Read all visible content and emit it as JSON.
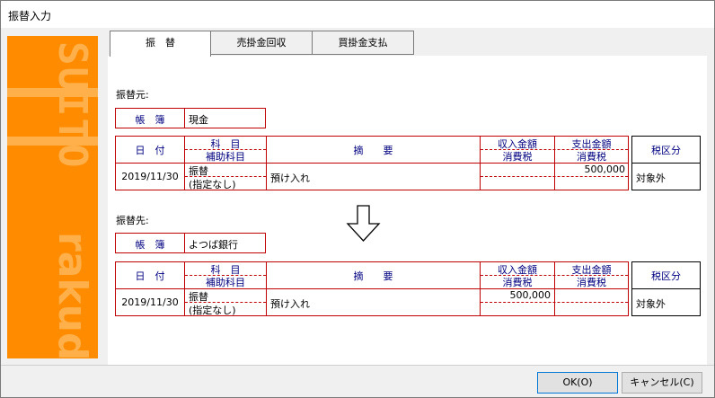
{
  "window": {
    "title": "振替入力"
  },
  "sidebar": {
    "logo_text_1": "SUITO",
    "logo_text_2": "rakuda"
  },
  "tabs": [
    {
      "label": "振　替",
      "active": true
    },
    {
      "label": "売掛金回収",
      "active": false
    },
    {
      "label": "買掛金支払",
      "active": false
    }
  ],
  "source": {
    "section_label": "振替元:",
    "book_label": "帳　簿",
    "book_value": "現金",
    "headers": {
      "date": "日　付",
      "account": "科　目",
      "sub_account": "補助科目",
      "summary": "摘　　要",
      "income": "収入金額",
      "income_tax": "消費税",
      "expense": "支出金額",
      "expense_tax": "消費税",
      "tax_class": "税区分"
    },
    "row": {
      "date": "2019/11/30",
      "account": "振替",
      "sub_account": "(指定なし)",
      "summary": "預け入れ",
      "income": "",
      "income_tax": "",
      "expense": "500,000",
      "expense_tax": "",
      "tax_class": "対象外"
    }
  },
  "destination": {
    "section_label": "振替先:",
    "book_label": "帳　簿",
    "book_value": "よつば銀行",
    "headers": {
      "date": "日　付",
      "account": "科　目",
      "sub_account": "補助科目",
      "summary": "摘　　要",
      "income": "収入金額",
      "income_tax": "消費税",
      "expense": "支出金額",
      "expense_tax": "消費税",
      "tax_class": "税区分"
    },
    "row": {
      "date": "2019/11/30",
      "account": "振替",
      "sub_account": "(指定なし)",
      "summary": "預け入れ",
      "income": "500,000",
      "income_tax": "",
      "expense": "",
      "expense_tax": "",
      "tax_class": "対象外"
    }
  },
  "buttons": {
    "ok": "OK(O)",
    "cancel": "キャンセル(C)"
  }
}
